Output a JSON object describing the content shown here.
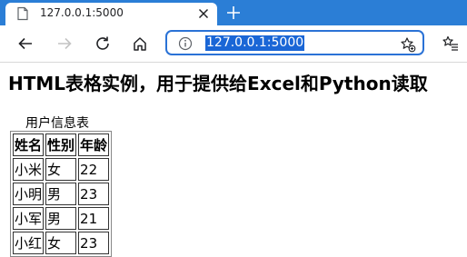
{
  "browser": {
    "tab": {
      "title": "127.0.0.1:5000"
    },
    "address": {
      "url": "127.0.0.1:5000"
    }
  },
  "page": {
    "heading": "HTML表格实例，用于提供给Excel和Python读取",
    "table": {
      "caption": "用户信息表",
      "headers": [
        "姓名",
        "性别",
        "年龄"
      ],
      "rows": [
        [
          "小米",
          "女",
          "22"
        ],
        [
          "小明",
          "男",
          "23"
        ],
        [
          "小军",
          "男",
          "21"
        ],
        [
          "小红",
          "女",
          "23"
        ]
      ]
    }
  },
  "icons": {
    "favicon": "page-icon",
    "tab_close": "close-icon",
    "new_tab": "plus-icon",
    "back": "arrow-left-icon",
    "forward": "arrow-right-icon",
    "reload": "reload-icon",
    "home": "home-icon",
    "site_info": "info-icon",
    "add_favorite": "star-plus-icon",
    "favorites": "favorites-icon"
  },
  "colors": {
    "tabstrip": "#2b7ed6",
    "address_border": "#2a72d6",
    "url_selection": "#1a66d6"
  }
}
